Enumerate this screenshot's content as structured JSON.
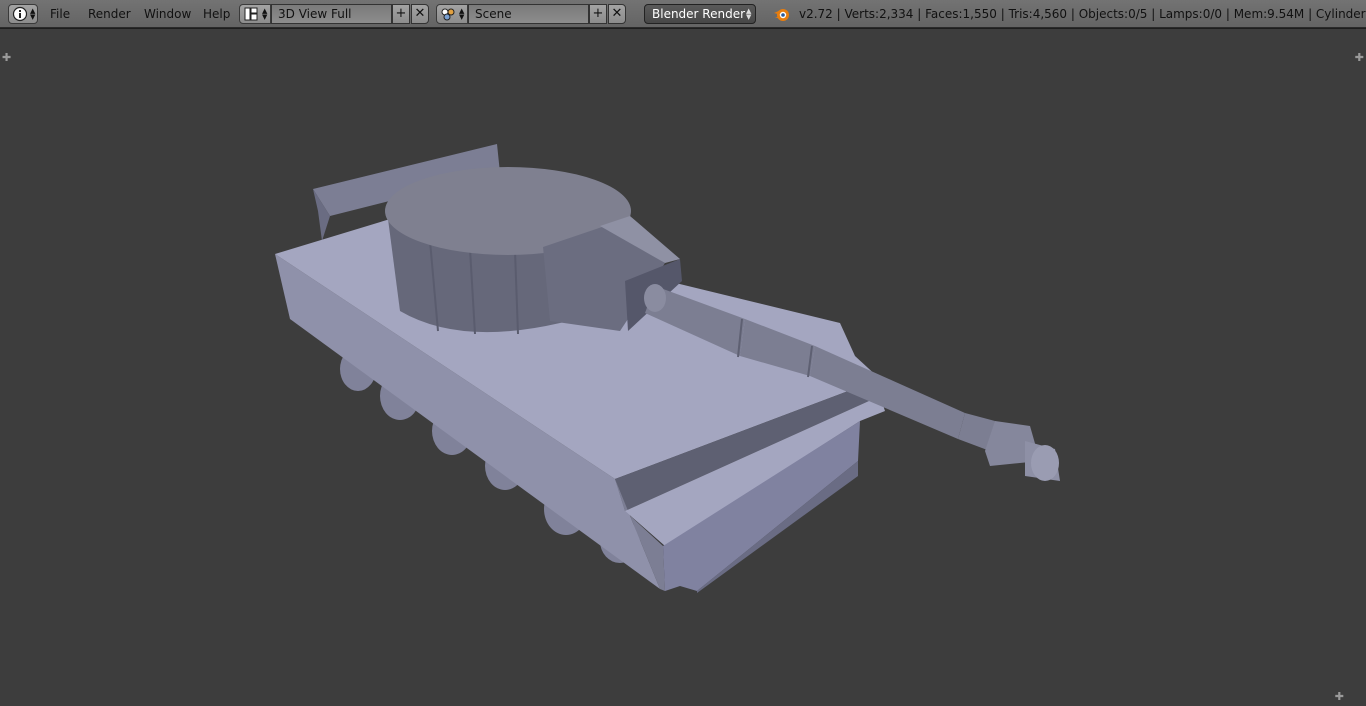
{
  "header": {
    "editor_type_icon": "info-icon",
    "menus": [
      "File",
      "Render",
      "Window",
      "Help"
    ],
    "screen_layout": {
      "icon": "layout-grid-icon",
      "value": "3D View Full"
    },
    "scene": {
      "icon": "scene-icon",
      "value": "Scene"
    },
    "render_engine": "Blender Render",
    "blender_logo_icon": "blender-logo-icon",
    "stats": "v2.72 | Verts:2,334 | Faces:1,550 | Tris:4,560 | Objects:0/5 | Lamps:0/0 | Mem:9.54M | Cylinder"
  },
  "viewport": {
    "object_name": "Cylinder",
    "colors": {
      "background": "#3d3d3d",
      "mesh_light": "#a4a6c0",
      "mesh_mid": "#8c8ea6",
      "mesh_dark": "#5e6072"
    }
  }
}
